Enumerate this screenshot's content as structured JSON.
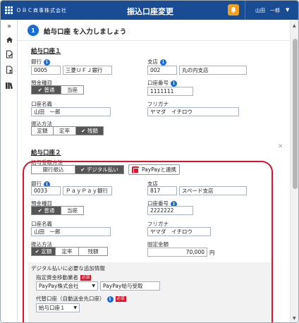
{
  "header": {
    "company": "ＯＢＣ商事株式会社",
    "title": "振込口座変更",
    "user": "山田　一郎"
  },
  "step": {
    "number": "1",
    "title": "給与口座 を入力しましょう"
  },
  "account1": {
    "title": "給与口座１",
    "bank_label": "銀行",
    "bank_code": "0005",
    "bank_name": "三菱ＵＦＪ銀行",
    "branch_label": "支店",
    "branch_code": "002",
    "branch_name": "丸の内支店",
    "type_label": "預金種目",
    "type_options": [
      "普通",
      "当座"
    ],
    "type_selected": "普通",
    "number_label": "口座番号",
    "number_value": "1111111",
    "holder_label": "口座名義",
    "holder_value": "山田　一郎",
    "kana_label": "フリガナ",
    "kana_value": "ヤマダ　イチロウ",
    "method_label": "振込方法",
    "method_options": [
      "定額",
      "定率",
      "残額"
    ],
    "method_selected": "残額"
  },
  "account2": {
    "title": "給与口座２",
    "receive_label": "給与受取方法",
    "receive_options": [
      "銀行振込",
      "デジタル払い"
    ],
    "receive_selected": "デジタル払い",
    "paypay_button": "PayPayと連携",
    "bank_label": "銀行",
    "bank_code": "0033",
    "bank_name": "ＰａｙＰａｙ銀行",
    "branch_label": "支店",
    "branch_code": "817",
    "branch_name": "スペード支店",
    "type_label": "預金種目",
    "type_options": [
      "普通",
      "当座"
    ],
    "type_selected": "普通",
    "number_label": "口座番号",
    "number_value": "2222222",
    "holder_label": "口座名義",
    "holder_value": "山田　一郎",
    "kana_label": "フリガナ",
    "kana_value": "ヤマダ　イチロウ",
    "method_label": "振込方法",
    "method_options": [
      "定額",
      "定率",
      "残額"
    ],
    "method_selected": "定額",
    "fixed_label": "固定金額",
    "fixed_value": "70,000",
    "fixed_unit": "円"
  },
  "digital": {
    "section_label": "デジタル払いに必要な追加情報",
    "provider_label": "指定資金移動業者",
    "required": "必須",
    "provider_select": "PayPay株式会社",
    "provider_text": "PayPay給与受取",
    "alt_label": "代替口座（自動送金先口座）",
    "alt_select": "給与口座１"
  },
  "colors": {
    "header_bg": "#1a4c93",
    "accent_blue": "#1a6dd0",
    "highlight_red": "#e0112b",
    "bell_orange": "#f0a020",
    "selected_grey": "#555555"
  },
  "icons": [
    "grid-icon",
    "bell-icon",
    "chevron-down-icon",
    "double-chevron-right-icon",
    "home-icon",
    "document-check-icon",
    "document-person-icon",
    "books-icon",
    "info-icon",
    "check-icon",
    "close-icon",
    "paypay-logo-icon"
  ]
}
